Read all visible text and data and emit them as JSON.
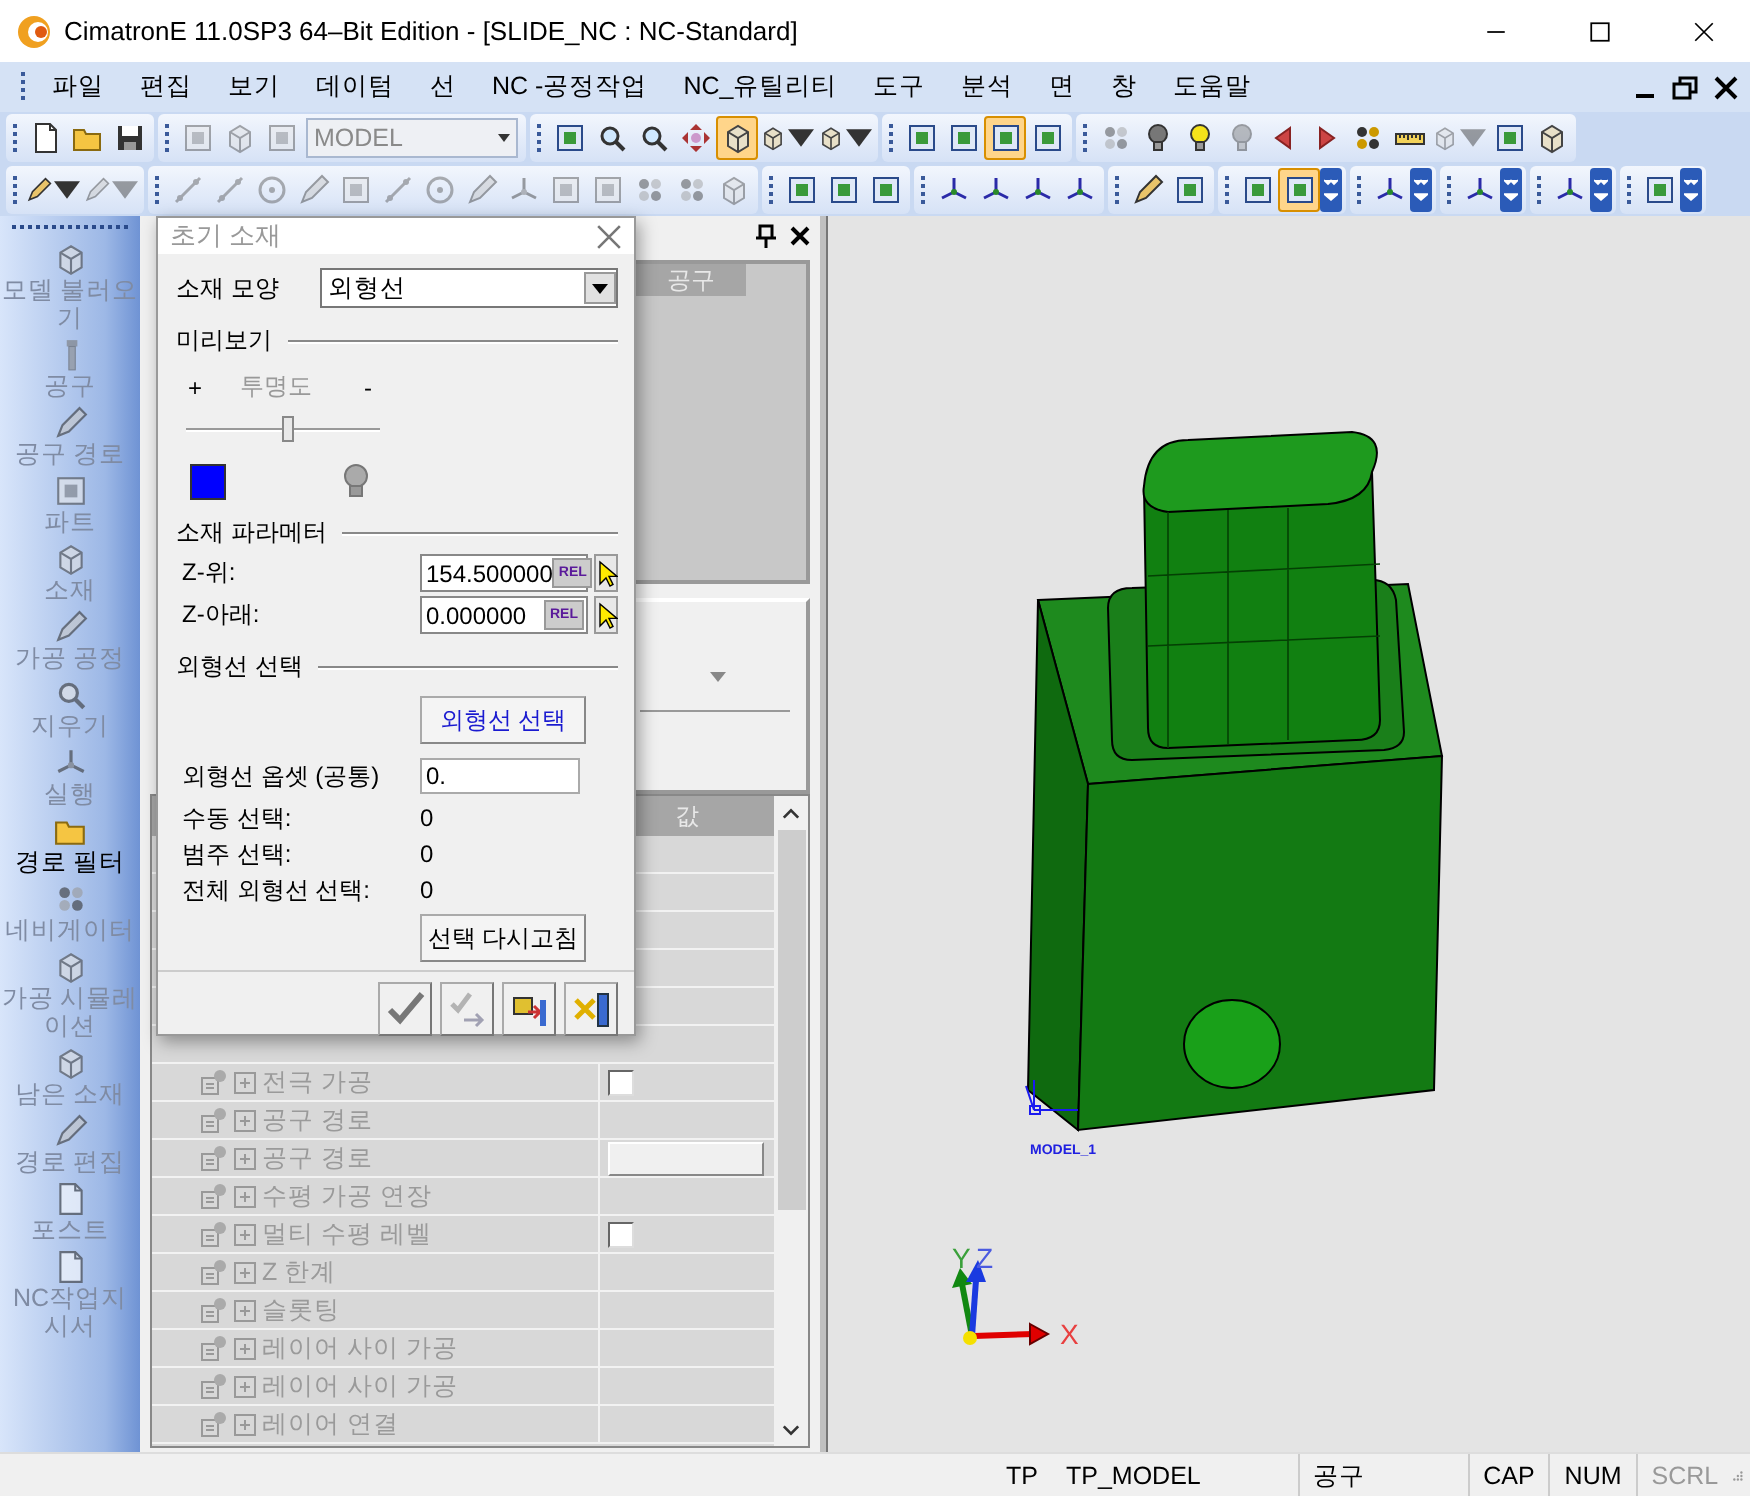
{
  "window": {
    "title": "CimatronE 11.0SP3 64–Bit Edition - [SLIDE_NC : NC-Standard]"
  },
  "menu": [
    "파일",
    "편집",
    "보기",
    "데이텀",
    "선",
    "NC -공정작업",
    "NC_유틸리티",
    "도구",
    "분석",
    "면",
    "창",
    "도움말"
  ],
  "toolbar_rows": [
    [
      {
        "overflow": false,
        "items": [
          {
            "kind": "button",
            "pressed": false,
            "disabled": false
          },
          {
            "kind": "button",
            "pressed": false,
            "disabled": false
          },
          {
            "kind": "button",
            "pressed": false,
            "disabled": false
          }
        ]
      },
      {
        "overflow": false,
        "items": [
          {
            "kind": "button",
            "pressed": false,
            "disabled": true
          },
          {
            "kind": "button",
            "pressed": false,
            "disabled": true
          },
          {
            "kind": "button",
            "pressed": false,
            "disabled": true
          },
          {
            "kind": "combo",
            "value": "MODEL",
            "disabled": true
          }
        ]
      },
      {
        "overflow": false,
        "items": [
          {
            "kind": "button",
            "pressed": false,
            "disabled": false
          },
          {
            "kind": "button",
            "pressed": false,
            "disabled": false
          },
          {
            "kind": "button",
            "pressed": false,
            "disabled": false
          },
          {
            "kind": "button",
            "pressed": false,
            "disabled": false
          },
          {
            "kind": "button",
            "pressed": true,
            "disabled": false
          },
          {
            "kind": "split",
            "pressed": false,
            "disabled": false
          },
          {
            "kind": "split",
            "pressed": false,
            "disabled": false
          }
        ]
      },
      {
        "overflow": false,
        "items": [
          {
            "kind": "button",
            "pressed": false,
            "disabled": false
          },
          {
            "kind": "button",
            "pressed": false,
            "disabled": false
          },
          {
            "kind": "button",
            "pressed": true,
            "disabled": false
          },
          {
            "kind": "button",
            "pressed": false,
            "disabled": false
          }
        ]
      },
      {
        "overflow": false,
        "items": [
          {
            "kind": "button",
            "pressed": false,
            "disabled": true
          },
          {
            "kind": "button",
            "pressed": false,
            "disabled": false
          },
          {
            "kind": "button",
            "pressed": false,
            "disabled": false
          },
          {
            "kind": "button",
            "pressed": false,
            "disabled": true
          },
          {
            "kind": "button",
            "pressed": false,
            "disabled": false
          },
          {
            "kind": "button",
            "pressed": false,
            "disabled": false
          },
          {
            "kind": "button",
            "pressed": false,
            "disabled": false
          },
          {
            "kind": "button",
            "pressed": false,
            "disabled": false
          },
          {
            "kind": "split",
            "pressed": false,
            "disabled": true
          },
          {
            "kind": "button",
            "pressed": false,
            "disabled": false
          },
          {
            "kind": "button",
            "pressed": false,
            "disabled": false
          }
        ]
      }
    ],
    [
      {
        "overflow": false,
        "items": [
          {
            "kind": "split",
            "pressed": false,
            "disabled": false
          },
          {
            "kind": "split",
            "pressed": false,
            "disabled": true
          }
        ]
      },
      {
        "overflow": false,
        "items": [
          {
            "kind": "button",
            "pressed": false,
            "disabled": true
          },
          {
            "kind": "button",
            "pressed": false,
            "disabled": true
          },
          {
            "kind": "button",
            "pressed": false,
            "disabled": true
          },
          {
            "kind": "button",
            "pressed": false,
            "disabled": true
          },
          {
            "kind": "button",
            "pressed": false,
            "disabled": true
          },
          {
            "kind": "button",
            "pressed": false,
            "disabled": true
          },
          {
            "kind": "button",
            "pressed": false,
            "disabled": true
          },
          {
            "kind": "button",
            "pressed": false,
            "disabled": true
          },
          {
            "kind": "button",
            "pressed": false,
            "disabled": true
          },
          {
            "kind": "button",
            "pressed": false,
            "disabled": true
          },
          {
            "kind": "button",
            "pressed": false,
            "disabled": true
          },
          {
            "kind": "button",
            "pressed": false,
            "disabled": true
          },
          {
            "kind": "button",
            "pressed": false,
            "disabled": true
          },
          {
            "kind": "button",
            "pressed": false,
            "disabled": true
          }
        ]
      },
      {
        "overflow": false,
        "items": [
          {
            "kind": "button",
            "pressed": false,
            "disabled": false
          },
          {
            "kind": "button",
            "pressed": false,
            "disabled": false
          },
          {
            "kind": "button",
            "pressed": false,
            "disabled": false
          }
        ]
      },
      {
        "overflow": false,
        "items": [
          {
            "kind": "button",
            "pressed": false,
            "disabled": false
          },
          {
            "kind": "button",
            "pressed": false,
            "disabled": false
          },
          {
            "kind": "button",
            "pressed": false,
            "disabled": false
          },
          {
            "kind": "button",
            "pressed": false,
            "disabled": false
          }
        ]
      },
      {
        "overflow": false,
        "items": [
          {
            "kind": "button",
            "pressed": false,
            "disabled": false
          },
          {
            "kind": "button",
            "pressed": false,
            "disabled": false
          }
        ]
      },
      {
        "overflow": true,
        "items": [
          {
            "kind": "button",
            "pressed": false,
            "disabled": false
          },
          {
            "kind": "button",
            "pressed": true,
            "disabled": false
          }
        ]
      },
      {
        "overflow": true,
        "items": [
          {
            "kind": "button",
            "pressed": false,
            "disabled": false
          }
        ]
      },
      {
        "overflow": true,
        "items": [
          {
            "kind": "button",
            "pressed": false,
            "disabled": false
          }
        ]
      },
      {
        "overflow": true,
        "items": [
          {
            "kind": "button",
            "pressed": false,
            "disabled": false
          }
        ]
      },
      {
        "overflow": true,
        "items": [
          {
            "kind": "button",
            "pressed": false,
            "disabled": false
          }
        ]
      }
    ]
  ],
  "sidebar": {
    "items": [
      {
        "label": "모델 불러오기",
        "disabled": true
      },
      {
        "label": "공구",
        "disabled": true
      },
      {
        "label": "공구 경로",
        "disabled": true
      },
      {
        "label": "파트",
        "disabled": true
      },
      {
        "label": "소재",
        "disabled": true
      },
      {
        "label": "가공 공정",
        "disabled": true
      },
      {
        "label": "지우기",
        "disabled": true
      },
      {
        "label": "실행",
        "disabled": true
      },
      {
        "label": "경로 필터",
        "disabled": false
      },
      {
        "label": "네비게이터",
        "disabled": true
      },
      {
        "label": "가공 시뮬레이션",
        "disabled": true
      },
      {
        "label": "남은 소재",
        "disabled": true
      },
      {
        "label": "경로 편집",
        "disabled": true
      },
      {
        "label": "포스트",
        "disabled": true
      },
      {
        "label": "NC작업지시서",
        "disabled": true
      }
    ]
  },
  "pane": {
    "tool_column": "공구",
    "value_column": "값",
    "rows": [
      {
        "label": "전극 가공",
        "kind": "checkbox",
        "checked": false
      },
      {
        "label": "공구 경로",
        "kind": "plain"
      },
      {
        "label": "공구 경로",
        "kind": "field"
      },
      {
        "label": "수평 가공 연장",
        "kind": "plain"
      },
      {
        "label": "멀티 수평 레벨",
        "kind": "checkbox",
        "checked": false
      },
      {
        "label": "Z 한계",
        "kind": "plain"
      },
      {
        "label": "슬롯팅",
        "kind": "plain"
      },
      {
        "label": "레이어 사이 가공",
        "kind": "plain"
      },
      {
        "label": "레이어 사이 가공",
        "kind": "plain"
      },
      {
        "label": "레이어 연결",
        "kind": "plain"
      }
    ]
  },
  "dialog": {
    "title": "초기 소재",
    "shape": {
      "label": "소재 모양",
      "value": "외형선"
    },
    "preview": {
      "heading": "미리보기",
      "plus": "+",
      "transparency_label": "투명도",
      "minus": "-",
      "transparency": {
        "level": 0.53
      },
      "color": "#0000ff"
    },
    "parameters": {
      "heading": "소재 파라메터",
      "fields": [
        {
          "label": "Z-위:",
          "value": "154.500000",
          "unit_button": "REL"
        },
        {
          "label": "Z-아래:",
          "value": "0.000000",
          "unit_button": "REL"
        }
      ]
    },
    "contour": {
      "heading": "외형선 선택",
      "select_button": "외형선 선택",
      "offset_label": "외형선 옵셋 (공통)",
      "offset_value": "0.",
      "counts": [
        {
          "label": "수동 선택:",
          "value": "0"
        },
        {
          "label": "범주 선택:",
          "value": "0"
        },
        {
          "label": "전체 외형선 선택:",
          "value": "0"
        }
      ],
      "refresh_button": "선택 다시고침"
    },
    "footer_buttons": [
      {
        "disabled": false
      },
      {
        "disabled": true
      },
      {
        "disabled": false
      },
      {
        "disabled": false
      }
    ]
  },
  "viewport": {
    "model_label": "MODEL_1",
    "axes": {
      "x": "X",
      "y": "Y",
      "z": "Z"
    }
  },
  "status_bar": [
    {
      "text": "TP",
      "disabled": false
    },
    {
      "text": "TP_MODEL",
      "disabled": false
    },
    {
      "text": "공구",
      "disabled": false
    },
    {
      "text": "CAP",
      "disabled": false
    },
    {
      "text": "NUM",
      "disabled": false
    },
    {
      "text": "SCRL",
      "disabled": true
    }
  ]
}
